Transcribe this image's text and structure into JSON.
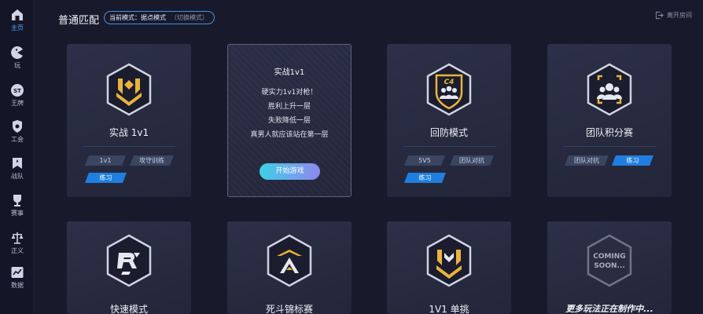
{
  "sidebar": {
    "items": [
      {
        "label": "主页",
        "icon": "home-icon",
        "active": true
      },
      {
        "label": "玩",
        "icon": "pacman-icon",
        "active": false
      },
      {
        "label": "王牌",
        "icon": "st-badge-icon",
        "active": false
      },
      {
        "label": "工会",
        "icon": "guild-shield-icon",
        "active": false
      },
      {
        "label": "战队",
        "icon": "team-banner-icon",
        "active": false
      },
      {
        "label": "赛事",
        "icon": "trophy-icon",
        "active": false
      },
      {
        "label": "正义",
        "icon": "scales-icon",
        "active": false
      },
      {
        "label": "数据",
        "icon": "chart-icon",
        "active": false
      }
    ]
  },
  "header": {
    "title": "普通匹配",
    "mode_current": "当前模式：据点模式",
    "mode_switch": "（切换模式）",
    "leave_label": "离开房间"
  },
  "cards": {
    "solo1v1": {
      "title": "实战 1v1",
      "tags": [
        "1v1",
        "攻守训练",
        "练习"
      ]
    },
    "hover": {
      "title": "实战1v1",
      "lines": [
        "硬实力1v1对枪！",
        "胜利上升一层",
        "失败降低一层",
        "真男人就应该站在第一层"
      ],
      "button": "开始游戏"
    },
    "defense": {
      "title": "回防模式",
      "tags": [
        "5V5",
        "团队对抗",
        "练习"
      ],
      "emblem_text": "C4"
    },
    "team_points": {
      "title": "团队积分赛",
      "tags": [
        "团队对抗",
        "练习"
      ]
    },
    "quick": {
      "title": "快速模式"
    },
    "deathmatch": {
      "title": "死斗锦标赛"
    },
    "solo_challenge": {
      "title": "1V1 单挑"
    },
    "coming": {
      "emblem_line1": "COMING",
      "emblem_line2": "SOON...",
      "title": "更多玩法正在制作中..."
    }
  },
  "colors": {
    "background": "#181a2c",
    "accent_blue": "#1f7fe0",
    "emblem_gold": "#e9b43c",
    "card_bg": "#2c3048"
  }
}
